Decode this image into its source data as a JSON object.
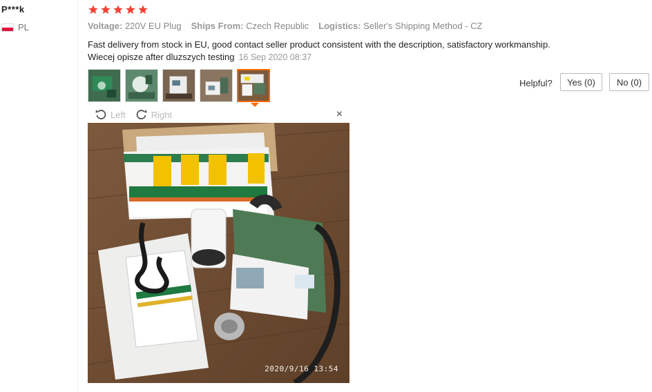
{
  "reviewer": {
    "name": "P***k",
    "country": "PL"
  },
  "rating": {
    "stars": 5,
    "max": 5,
    "color": "#f44336"
  },
  "properties": [
    {
      "name": "Voltage:",
      "value": "220V EU Plug"
    },
    {
      "name": "Ships From:",
      "value": "Czech Republic"
    },
    {
      "name": "Logistics:",
      "value": "Seller's Shipping Method - CZ"
    }
  ],
  "feedback": {
    "line1": "Fast delivery from stock in EU, good contact seller product consistent with the description, satisfactory workmanship.",
    "line2": "Wiecej opisze after dluzszych testing",
    "date": "16 Sep 2020 08:37"
  },
  "thumbnails": [
    {
      "name": "photo-1",
      "active": false
    },
    {
      "name": "photo-2",
      "active": false
    },
    {
      "name": "photo-3",
      "active": false
    },
    {
      "name": "photo-4",
      "active": false
    },
    {
      "name": "photo-5",
      "active": true
    }
  ],
  "helpful": {
    "label": "Helpful?",
    "yes": "Yes (0)",
    "no": "No (0)"
  },
  "viewer": {
    "rotate_left": "Left",
    "rotate_right": "Right",
    "close": "×",
    "timestamp": "2020/9/16 13:54"
  },
  "colors": {
    "accent": "#ff6a00",
    "star": "#f44336"
  }
}
